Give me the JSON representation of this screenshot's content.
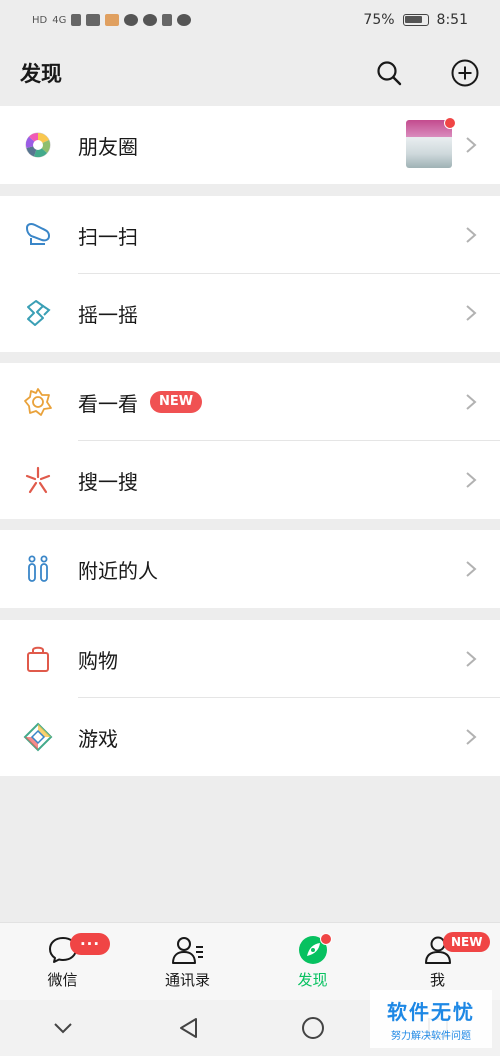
{
  "status_bar": {
    "left_label": "HD",
    "signal_label": "4G",
    "battery": "75%",
    "time": "8:51"
  },
  "header": {
    "title": "发现",
    "icons": [
      "search-icon",
      "add-circle-icon"
    ]
  },
  "menu": {
    "moments": {
      "label": "朋友圈",
      "icon": "moments-aperture-icon",
      "has_thumbnail": true,
      "has_dot": true
    },
    "scan": {
      "label": "扫一扫",
      "icon": "scan-icon"
    },
    "shake": {
      "label": "摇一摇",
      "icon": "shake-icon"
    },
    "top_stories": {
      "label": "看一看",
      "icon": "top-stories-icon",
      "badge": "NEW"
    },
    "search": {
      "label": "搜一搜",
      "icon": "search-star-icon"
    },
    "nearby": {
      "label": "附近的人",
      "icon": "people-nearby-icon"
    },
    "shopping": {
      "label": "购物",
      "icon": "shopping-bag-icon"
    },
    "games": {
      "label": "游戏",
      "icon": "games-icon"
    }
  },
  "bottom_nav": {
    "items": [
      {
        "label": "微信",
        "icon": "chat-bubble-icon",
        "badge": "···"
      },
      {
        "label": "通讯录",
        "icon": "contacts-icon"
      },
      {
        "label": "发现",
        "icon": "discover-compass-icon",
        "active": true,
        "dot": true
      },
      {
        "label": "我",
        "icon": "me-person-icon",
        "badge": "NEW"
      }
    ]
  },
  "watermark": {
    "title": "软件无忧",
    "subtitle": "努力解决软件问题"
  },
  "colors": {
    "accent_green": "#07c160",
    "badge_red": "#f04545",
    "background": "#ededed"
  }
}
